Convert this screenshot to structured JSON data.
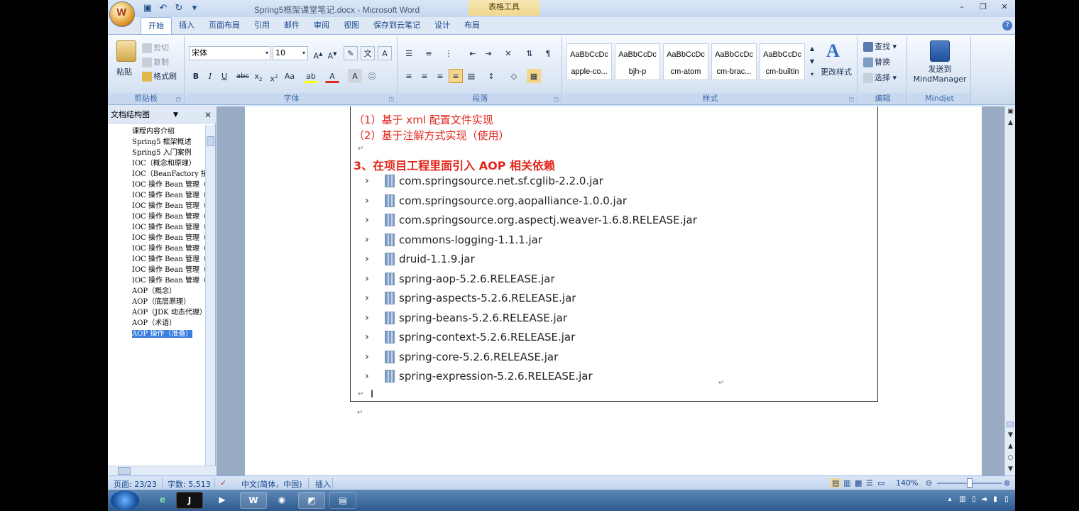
{
  "window": {
    "title": "Spring5框架课堂笔记.docx - Microsoft Word",
    "context_tab_title": "表格工具"
  },
  "ribbon_tabs": [
    "开始",
    "插入",
    "页面布局",
    "引用",
    "邮件",
    "审阅",
    "视图",
    "保存到云笔记",
    "设计",
    "布局"
  ],
  "clipboard": {
    "label": "剪贴板",
    "paste": "粘贴",
    "cut": "剪切",
    "copy": "复制",
    "format_painter": "格式刷"
  },
  "font": {
    "label": "字体",
    "font_name": "宋体",
    "font_size": "10"
  },
  "paragraph": {
    "label": "段落"
  },
  "styles": {
    "label": "样式",
    "sample": "AaBbCcDc",
    "items": [
      "apple-co...",
      "bjh-p",
      "cm-atom",
      "cm-brac...",
      "cm-builtin"
    ],
    "change_styles": "更改样式"
  },
  "editing": {
    "label": "编辑",
    "find": "查找",
    "replace": "替换",
    "select": "选择"
  },
  "mindjet": {
    "label": "Mindjet",
    "send_line1": "发送到",
    "send_line2": "MindManager"
  },
  "docmap": {
    "dropdown_value": "文档结构图",
    "items": [
      "课程内容介绍",
      "Spring5 框架概述",
      "Spring5 入门案例",
      "IOC（概念和原理）",
      "IOC（BeanFactory 接",
      "IOC 操作 Bean 管理（",
      "IOC 操作 Bean 管理（",
      "IOC 操作 Bean 管理（",
      "IOC 操作 Bean 管理（",
      "IOC 操作 Bean 管理（",
      "IOC 操作 Bean 管理（",
      "IOC 操作 Bean 管理（",
      "IOC 操作 Bean 管理（",
      "IOC 操作 Bean 管理（",
      "IOC 操作 Bean 管理（",
      "AOP（概念）",
      "AOP（底层原理）",
      "AOP（JDK 动态代理）",
      "AOP（术语）",
      "AOP 操作（准备）"
    ]
  },
  "document": {
    "line1": "（1）基于 xml 配置文件实现",
    "line2": "（2）基于注解方式实现（使用）",
    "heading": "3、在项目工程里面引入 AOP 相关依赖",
    "jars": [
      "com.springsource.net.sf.cglib-2.2.0.jar",
      "com.springsource.org.aopalliance-1.0.0.jar",
      "com.springsource.org.aspectj.weaver-1.6.8.RELEASE.jar",
      "commons-logging-1.1.1.jar",
      "druid-1.1.9.jar",
      "spring-aop-5.2.6.RELEASE.jar",
      "spring-aspects-5.2.6.RELEASE.jar",
      "spring-beans-5.2.6.RELEASE.jar",
      "spring-context-5.2.6.RELEASE.jar",
      "spring-core-5.2.6.RELEASE.jar",
      "spring-expression-5.2.6.RELEASE.jar"
    ]
  },
  "status": {
    "page": "页面: 23/23",
    "words": "字数: 5,513",
    "language": "中文(简体，中国)",
    "mode": "插入",
    "zoom": "140%"
  },
  "colors": {
    "accent_red": "#e1261c",
    "ribbon_blue": "#15428b"
  }
}
